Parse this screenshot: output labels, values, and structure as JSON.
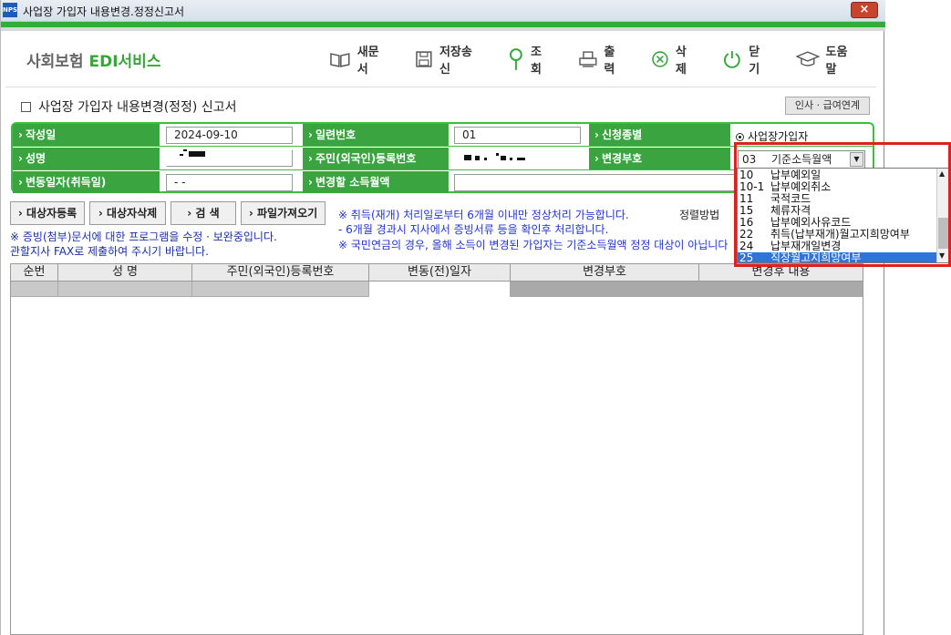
{
  "window": {
    "icon_text": "NPS",
    "title": "사업장 가입자 내용변경.정정신고서",
    "close": "×"
  },
  "logo": {
    "part1": "사회보험 ",
    "part2": "EDI서비스"
  },
  "toolbar": {
    "new_doc": "새문서",
    "save_send": "저장송신",
    "search": "조회",
    "print": "출력",
    "delete": "삭제",
    "close": "닫기",
    "help": "도움말"
  },
  "form": {
    "title": "사업장 가입자 내용변경(정정) 신고서",
    "hr_link": "인사 · 급여연계",
    "labels": {
      "date": "작성일",
      "serial": "일련번호",
      "report_type": "신청종별",
      "name": "성명",
      "resident_id": "주민(외국인)등록번호",
      "change_code": "변경부호",
      "change_date": "변동일자(취득일)",
      "income": "변경할 소득월액"
    },
    "values": {
      "date": "2024-09-10",
      "serial": "01",
      "change_date": "  -  -",
      "report_type": "사업장가입자"
    },
    "combo": {
      "code": "03",
      "label": "기준소득월액"
    }
  },
  "actions": {
    "register": "대상자등록",
    "remove": "대상자삭제",
    "search": "검    색",
    "import": "파일가져오기",
    "sort": "정렬방법"
  },
  "notes": {
    "left1": "※ 증빙(첨부)문서에 대한 프로그램을 수정 · 보완중입니다.",
    "left2": "   관할지사 FAX로 제출하여 주시기 바랍니다.",
    "right1": "※ 취득(재개) 처리일로부터 6개월 이내만 정상처리 가능합니다.",
    "right2": "   - 6개월 경과시 지사에서 증빙서류 등을 확인후 처리합니다.",
    "right3": "※ 국민연금의 경우, 올해 소득이 변경된 가입자는 기준소득월액 정정 대상이 아닙니다"
  },
  "table": {
    "headers": [
      "순번",
      "성  명",
      "주민(외국인)등록번호",
      "변동(전)일자",
      "변경부호",
      "변경후 내용"
    ]
  },
  "dropdown": {
    "items": [
      {
        "code": "10",
        "name": "납부예외일"
      },
      {
        "code": "10-1",
        "name": "납부예외취소"
      },
      {
        "code": "11",
        "name": "국적코드"
      },
      {
        "code": "15",
        "name": "체류자격"
      },
      {
        "code": "16",
        "name": "납부예외사유코드"
      },
      {
        "code": "22",
        "name": "취득(납부재개)월고지희망여부"
      },
      {
        "code": "24",
        "name": "납부재개일변경"
      },
      {
        "code": "25",
        "name": "직장월고지희망여부"
      }
    ]
  },
  "colors": {
    "accent_green": "#3aa440",
    "border_green": "#3cbf3c",
    "note_blue": "#2134cc",
    "highlight_red": "#e02020",
    "selected_blue": "#3173d6"
  }
}
